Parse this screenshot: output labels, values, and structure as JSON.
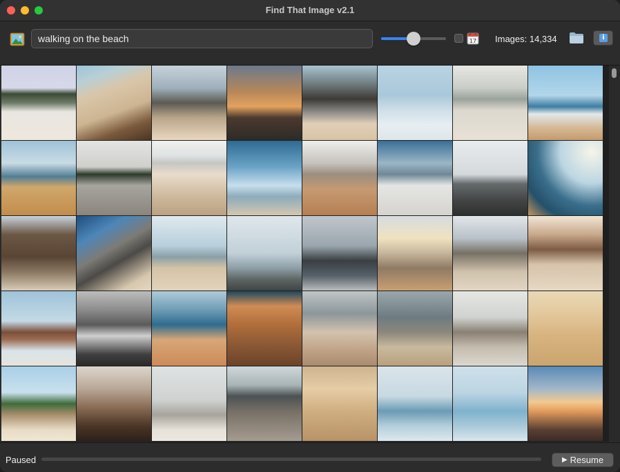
{
  "window": {
    "title": "Find That Image v2.1"
  },
  "toolbar": {
    "search_value": "walking on the beach",
    "similarity_slider": {
      "value": 0.5
    },
    "date_filter_checked": false,
    "image_count": "Images: 14,334",
    "icons": [
      "image-icon",
      "calendar-icon",
      "folder-icon",
      "info-icon"
    ]
  },
  "status": {
    "text": "Paused",
    "progress": 0,
    "resume_label": "Resume"
  },
  "colors": {
    "accent": "#3a82f7",
    "background": "#2b2b2b"
  },
  "tiles": [
    {
      "scene": "coast with trees, person walking",
      "bg": "linear-gradient(180deg,#cfd3e6 0%,#d7d9ea 30%,#3b4a34 38%,#6d7a67 50%,#e8e6e1 62%,#efe7dc 100%)"
    },
    {
      "scene": "sandy dune slope",
      "bg": "linear-gradient(160deg,#9cc3d9 0%,#b9cfd6 18%,#d9c6a9 35%,#cdb592 60%,#7b5a3d 80%,#4b3524 100%)"
    },
    {
      "scene": "person with dog closeup",
      "bg": "linear-gradient(180deg,#c7d2db 0%,#9fb0bb 30%,#5c5a54 50%,#b9a58a 70%,#e9d8c0 100%)"
    },
    {
      "scene": "sunset over sea",
      "bg": "linear-gradient(180deg,#6b7a8c 0%,#b7875a 35%,#e3a25d 55%,#4a3a2f 70%,#2e2a27 100%)"
    },
    {
      "scene": "cliffs and shore",
      "bg": "linear-gradient(180deg,#a9c4cf 0%,#6f7a7e 25%,#3e3a36 45%,#8b8a86 62%,#e0cfb8 78%,#d8c3a5 100%)"
    },
    {
      "scene": "person and dog on snowy beach",
      "bg": "linear-gradient(180deg,#b9d4e3 0%,#a9c8da 40%,#cfdfe8 60%,#e7eef2 80%,#dfe6ea 100%)"
    },
    {
      "scene": "foggy coast person standing",
      "bg": "linear-gradient(180deg,#e7e7e4 0%,#c9cdc8 30%,#9aa39b 45%,#ddd8cf 60%,#e7e1d6 100%)"
    },
    {
      "scene": "woman by waves",
      "bg": "linear-gradient(180deg,#8fc3e2 0%,#b2d6ea 40%,#3d7da1 55%,#e2e8ea 65%,#d4b591 85%,#c59a6e 100%)"
    },
    {
      "scene": "golden beach with cliff",
      "bg": "linear-gradient(180deg,#9fc2d9 0%,#c9dbe4 30%,#517f95 48%,#d0a76c 62%,#c28d4b 100%)"
    },
    {
      "scene": "foggy shore person with dog",
      "bg": "linear-gradient(180deg,#e4e4e2 0%,#cfd0cc 35%,#2e3a2c 45%,#a7a59f 60%,#8a857d 100%)"
    },
    {
      "scene": "tire tracks on sand",
      "bg": "linear-gradient(180deg,#f1f1ee 0%,#dfe2e2 20%,#c5c6c2 30%,#e9dccb 45%,#cdb89c 75%,#bba283 100%)"
    },
    {
      "scene": "blue sky clouds beach",
      "bg": "linear-gradient(180deg,#2f6a93 0%,#6aa3c6 35%,#c7dfed 60%,#8dabbb 75%,#d4c7b1 100%)"
    },
    {
      "scene": "hazy hills beach",
      "bg": "linear-gradient(180deg,#eeeeec 0%,#c6c2bc 30%,#9b8d7f 45%,#c69a72 65%,#b57f52 100%)"
    },
    {
      "scene": "city skyline beach",
      "bg": "linear-gradient(180deg,#3a6f96 0%,#9bb6c6 30%,#6f8796 45%,#e5e6e4 60%,#d5d3ce 100%)"
    },
    {
      "scene": "grey beach lone figure",
      "bg": "linear-gradient(180deg,#e9ecee 0%,#d4d9dc 45%,#646a6b 58%,#434545 80%,#2e3030 100%)"
    },
    {
      "scene": "wide angle sunny beach",
      "bg": "radial-gradient(circle at 85% 15%,#f6f4e8 0%,#bcd6e3 35%,#3b6f8c 60%,#24506a 80%,#c2945e 100%)"
    },
    {
      "scene": "rock formation",
      "bg": "linear-gradient(180deg,#c7d3dc 0%,#6b5744 25%,#5a4535 55%,#8a7761 75%,#d9ccb7 100%)"
    },
    {
      "scene": "big rock blue sky",
      "bg": "linear-gradient(150deg,#1f4d7f 0%,#4d86b8 25%,#7d7b76 45%,#4c4a46 60%,#d7c7ae 85%,#e6d7c1 100%)"
    },
    {
      "scene": "palm trees",
      "bg": "linear-gradient(180deg,#e0e9ee 0%,#b8cfdc 40%,#8aa0a7 55%,#d5c3a6 70%,#e2d3bd 100%)"
    },
    {
      "scene": "misty sea figure",
      "bg": "linear-gradient(180deg,#dfe7ec 0%,#c2d0d8 50%,#8d9ea6 70%,#5d6665 85%,#3f4544 100%)"
    },
    {
      "scene": "person in jacket by sea",
      "bg": "linear-gradient(180deg,#c0c7cc 0%,#9aa6ad 40%,#3a3f42 60%,#55606a 80%,#b9bcbc 100%)"
    },
    {
      "scene": "tide pools at sunset",
      "bg": "linear-gradient(180deg,#d6dce0 0%,#f0e2c0 30%,#c5b59b 50%,#8f7a63 70%,#c99f73 100%)"
    },
    {
      "scene": "woman near rocks",
      "bg": "linear-gradient(180deg,#e1e5e8 0%,#b9c2c9 30%,#767065 50%,#d0c2ac 75%,#e2d6c3 100%)"
    },
    {
      "scene": "cliffs at dusk",
      "bg": "linear-gradient(180deg,#f1e6d6 0%,#c8a88a 25%,#7d5b44 45%,#d6c3aa 65%,#e7d8c3 100%)"
    },
    {
      "scene": "rock with people",
      "bg": "linear-gradient(180deg,#9fc3d9 0%,#c3d9e5 40%,#7b4f3a 55%,#9b6e54 65%,#d9e4ea 80%,#e6e3dc 100%)"
    },
    {
      "scene": "black and white shore people",
      "bg": "linear-gradient(180deg,#bdbdbd 0%,#8c8c8c 25%,#5a5a5a 45%,#cfcfcf 60%,#3f3f3f 85%,#2a2a2a 100%)"
    },
    {
      "scene": "sun glare woman on sand",
      "bg": "linear-gradient(180deg,#b0cbd8 0%,#6e9cb6 25%,#2f6c8e 45%,#d7a777 65%,#cd8a58 100%)"
    },
    {
      "scene": "fluffy dog on sand",
      "bg": "linear-gradient(180deg,#1f4860 0%,#d08c55 20%,#b06e3b 45%,#8e5a36 70%,#6a4429 100%)"
    },
    {
      "scene": "pug with person",
      "bg": "linear-gradient(180deg,#c0c6c7 0%,#8c969a 30%,#d3c2ad 55%,#bfa286 80%,#a98b6f 100%)"
    },
    {
      "scene": "dog in surf",
      "bg": "linear-gradient(180deg,#9aa7ad 0%,#6e7b80 35%,#8b877c 55%,#c9b99e 75%,#b8a17e 100%)"
    },
    {
      "scene": "misty rocky shore",
      "bg": "linear-gradient(180deg,#e6e6e3 0%,#d1d3d0 35%,#8a8074 55%,#c4bcae 75%,#dcd7ce 100%)"
    },
    {
      "scene": "pug walking on sand",
      "bg": "linear-gradient(180deg,#e9d9b6 0%,#e3c89c 30%,#d7b37f 60%,#cba56f 100%)"
    },
    {
      "scene": "wooden fence dunes",
      "bg": "linear-gradient(180deg,#a9cfe7 0%,#c9e0ee 35%,#3f6b3a 50%,#a98f6e 65%,#e8dcc6 85%,#f0e6d3 100%)"
    },
    {
      "scene": "person walking sunset sand",
      "bg": "linear-gradient(180deg,#dcd6cc 0%,#b9a797 30%,#8a6c55 55%,#4b3526 80%,#2e2119 100%)"
    },
    {
      "scene": "foggy shore silhouettes",
      "bg": "linear-gradient(180deg,#dfe2e2 0%,#cfd2d1 45%,#a6a39c 65%,#e6e2d9 85%,#ece8e0 100%)"
    },
    {
      "scene": "person on wet sand",
      "bg": "linear-gradient(180deg,#cfd7da 0%,#a9b4b7 25%,#4b5254 40%,#776f66 60%,#a59b8f 100%)"
    },
    {
      "scene": "pug closeup",
      "bg": "linear-gradient(180deg,#cfb48f 0%,#e6cda6 30%,#cfae82 60%,#b89367 100%)"
    },
    {
      "scene": "flat calm sea",
      "bg": "linear-gradient(180deg,#d9e4ea 0%,#c8d9e2 40%,#6b9bb5 60%,#b4cfdc 80%,#dce8ee 100%)"
    },
    {
      "scene": "shallow water people",
      "bg": "linear-gradient(180deg,#cfe0ea 0%,#bcd5e3 35%,#7fb2cd 60%,#a9c9da 80%,#d9e6ed 100%)"
    },
    {
      "scene": "sunset with rocks",
      "bg": "linear-gradient(180deg,#5a8ab6 0%,#a2b7c9 30%,#f3c98f 48%,#e39b5c 60%,#5a3f33 85%,#3c2c25 100%)"
    }
  ]
}
